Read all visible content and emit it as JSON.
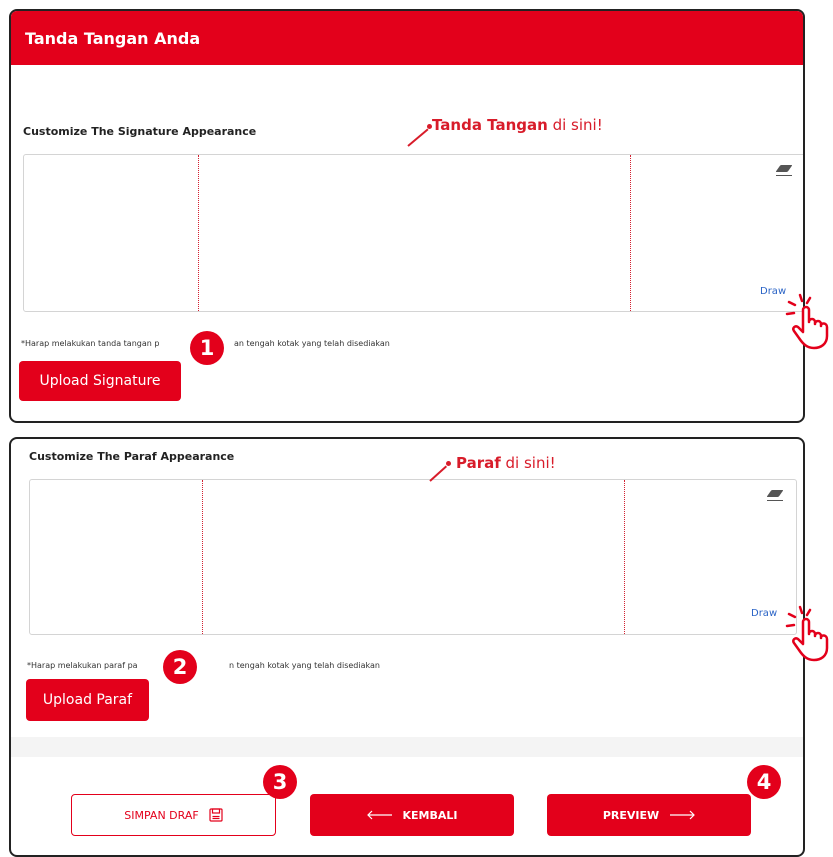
{
  "card1": {
    "header_title": "Tanda Tangan Anda",
    "section_title": "Customize The Signature Appearance",
    "annotation_bold": "Tanda Tangan",
    "annotation_rest": " di sini!",
    "draw_label": "Draw",
    "note_left": "*Harap melakukan tanda tangan p",
    "note_right": "an tengah kotak yang telah disediakan",
    "upload_label": "Upload Signature",
    "badge": "1"
  },
  "card2": {
    "section_title": "Customize The Paraf Appearance",
    "annotation_bold": "Paraf",
    "annotation_rest": " di sini!",
    "draw_label": "Draw",
    "note_left": "*Harap melakukan paraf pa",
    "note_right": "n tengah kotak yang telah disediakan",
    "upload_label": "Upload Paraf",
    "badge": "2"
  },
  "footer": {
    "save_draft_label": "SIMPAN DRAF",
    "back_label": "KEMBALI",
    "preview_label": "PREVIEW",
    "badge_save": "3",
    "badge_preview": "4"
  },
  "icons": {
    "eraser": "eraser-icon",
    "hand_pointer": "hand-pointer-icon",
    "floppy": "floppy-disk-icon",
    "arrow_left": "arrow-left-icon",
    "arrow_right": "arrow-right-icon"
  },
  "colors": {
    "brand_red": "#e3001b",
    "link_blue": "#2b64c6"
  }
}
